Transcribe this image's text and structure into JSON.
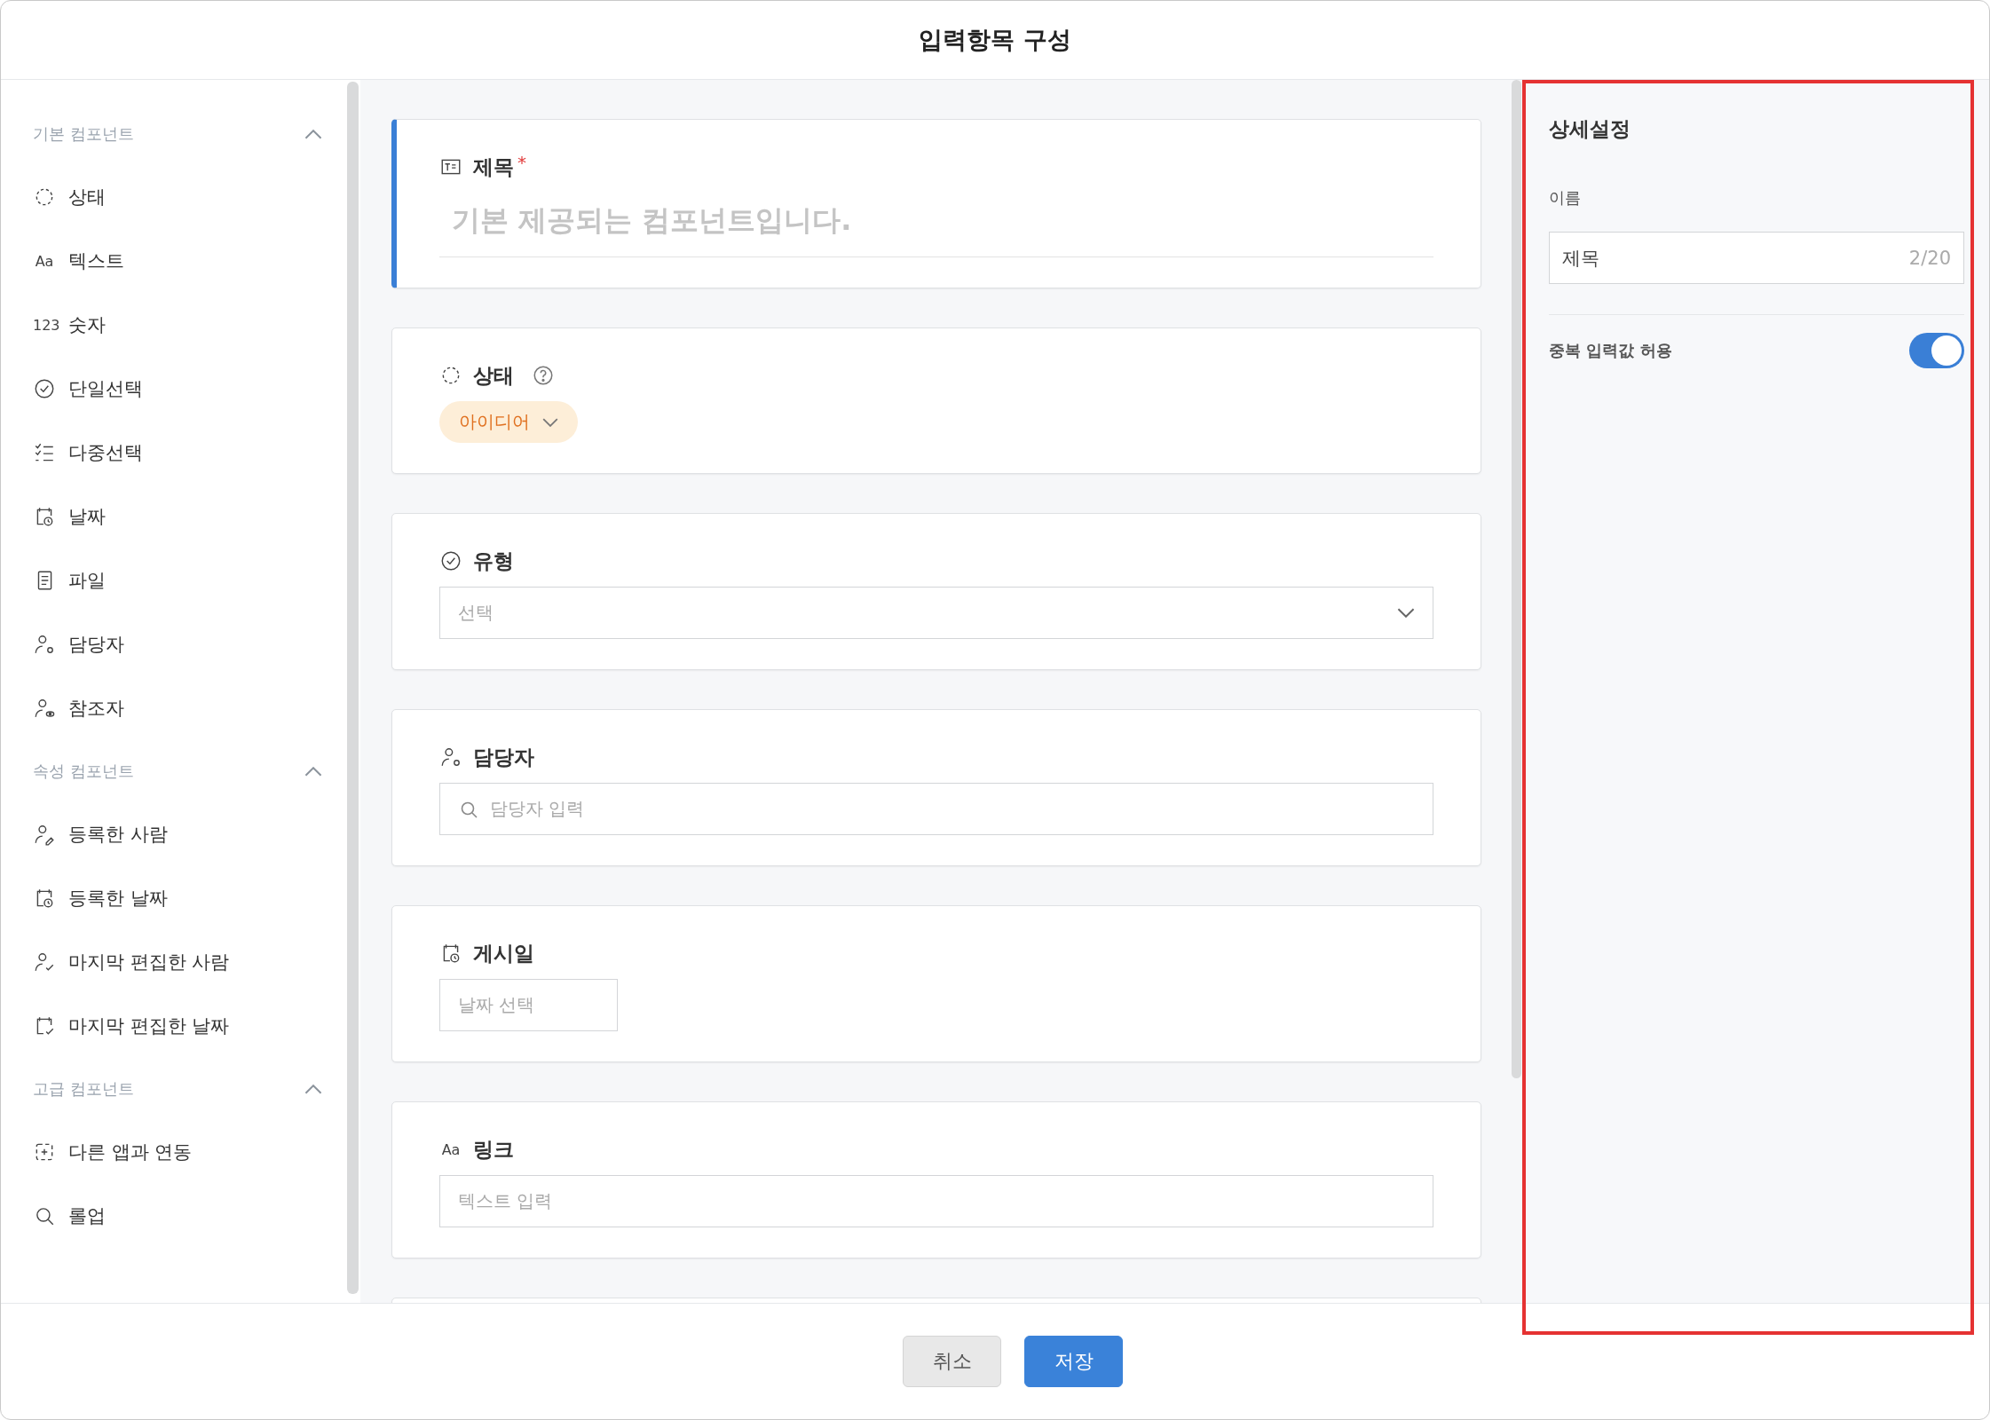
{
  "window": {
    "title": "입력항목 구성"
  },
  "sidebar": {
    "sections": [
      {
        "heading": "기본 컴포넌트",
        "expanded": true,
        "items": [
          {
            "label": "상태"
          },
          {
            "label": "텍스트",
            "glyph": "Aa"
          },
          {
            "label": "숫자",
            "glyph": "123"
          },
          {
            "label": "단일선택"
          },
          {
            "label": "다중선택"
          },
          {
            "label": "날짜"
          },
          {
            "label": "파일"
          },
          {
            "label": "담당자"
          },
          {
            "label": "참조자"
          }
        ]
      },
      {
        "heading": "속성 컴포넌트",
        "expanded": true,
        "items": [
          {
            "label": "등록한 사람"
          },
          {
            "label": "등록한 날짜"
          },
          {
            "label": "마지막 편집한 사람"
          },
          {
            "label": "마지막 편집한 날짜"
          }
        ]
      },
      {
        "heading": "고급 컴포넌트",
        "expanded": true,
        "items": [
          {
            "label": "다른 앱과 연동"
          },
          {
            "label": "롤업"
          }
        ]
      }
    ]
  },
  "cards": [
    {
      "kind": "title",
      "label": "제목",
      "required_mark": "*",
      "selected": true,
      "placeholder": "기본 제공되는 컴포넌트입니다."
    },
    {
      "kind": "status",
      "label": "상태",
      "help": true,
      "selected": false,
      "value": "아이디어"
    },
    {
      "kind": "select",
      "label": "유형",
      "selected": false,
      "placeholder": "선택"
    },
    {
      "kind": "search",
      "label": "담당자",
      "selected": false,
      "placeholder": "담당자 입력"
    },
    {
      "kind": "date",
      "label": "게시일",
      "selected": false,
      "placeholder": "날짜 선택"
    },
    {
      "kind": "text",
      "label": "링크",
      "glyph": "Aa",
      "selected": false,
      "placeholder": "텍스트 입력"
    },
    {
      "kind": "empty",
      "selected": false
    }
  ],
  "details": {
    "title": "상세설정",
    "name_label": "이름",
    "name_value": "제목",
    "counter": "2/20",
    "toggle": {
      "label": "중복 입력값 허용",
      "on": true
    }
  },
  "footer": {
    "buttons": [
      {
        "label": "취소",
        "kind": "secondary"
      },
      {
        "label": "저장",
        "kind": "primary"
      }
    ]
  }
}
